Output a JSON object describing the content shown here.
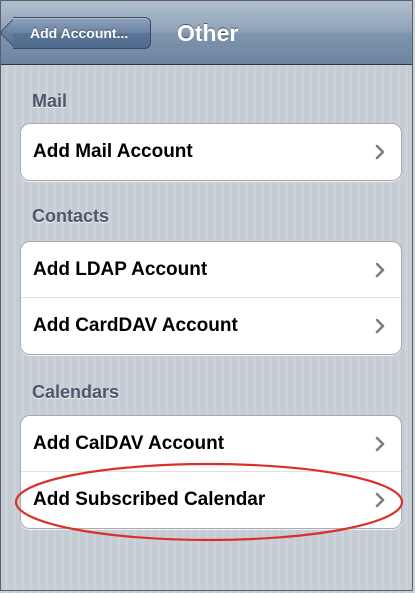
{
  "navbar": {
    "back_label": "Add Account...",
    "title": "Other"
  },
  "sections": {
    "mail": {
      "header": "Mail",
      "items": [
        {
          "label": "Add Mail Account"
        }
      ]
    },
    "contacts": {
      "header": "Contacts",
      "items": [
        {
          "label": "Add LDAP Account"
        },
        {
          "label": "Add CardDAV Account"
        }
      ]
    },
    "calendars": {
      "header": "Calendars",
      "items": [
        {
          "label": "Add CalDAV Account"
        },
        {
          "label": "Add Subscribed Calendar"
        }
      ]
    }
  },
  "icons": {
    "chevron": "chevron-right-icon",
    "back": "back-arrow-icon"
  },
  "colors": {
    "highlight": "#d9312a",
    "navbar": "#7f94ad",
    "section_header": "#4c566c",
    "background": "#c5ccd4"
  }
}
